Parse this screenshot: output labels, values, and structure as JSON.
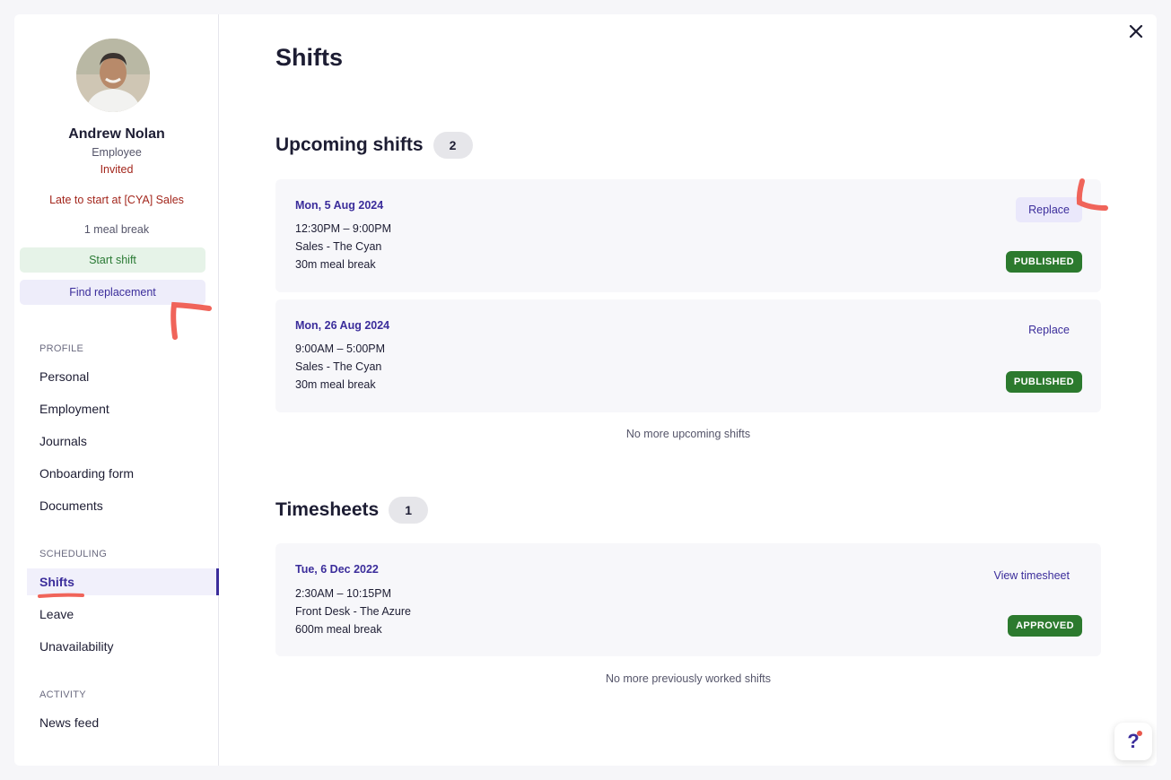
{
  "profile": {
    "name": "Andrew Nolan",
    "role": "Employee",
    "status": "Invited",
    "late_notice": "Late to start at [CYA] Sales",
    "meal_breaks": "1 meal break",
    "start_shift_label": "Start shift",
    "find_replacement_label": "Find replacement"
  },
  "sidebar": {
    "sections": [
      {
        "label": "PROFILE",
        "items": [
          "Personal",
          "Employment",
          "Journals",
          "Onboarding form",
          "Documents"
        ]
      },
      {
        "label": "SCHEDULING",
        "items": [
          "Shifts",
          "Leave",
          "Unavailability"
        ]
      },
      {
        "label": "ACTIVITY",
        "items": [
          "News feed"
        ]
      }
    ],
    "active_item": "Shifts"
  },
  "main": {
    "title": "Shifts",
    "upcoming": {
      "title": "Upcoming shifts",
      "count": "2",
      "shifts": [
        {
          "date": "Mon, 5 Aug 2024",
          "time": "12:30PM – 9:00PM",
          "location": "Sales - The Cyan",
          "break": "30m meal break",
          "action": "Replace",
          "status": "PUBLISHED"
        },
        {
          "date": "Mon, 26 Aug 2024",
          "time": "9:00AM – 5:00PM",
          "location": "Sales - The Cyan",
          "break": "30m meal break",
          "action": "Replace",
          "status": "PUBLISHED"
        }
      ],
      "empty_note": "No more upcoming shifts"
    },
    "timesheets": {
      "title": "Timesheets",
      "count": "1",
      "items": [
        {
          "date": "Tue, 6 Dec 2022",
          "time": "2:30AM – 10:15PM",
          "location": "Front Desk - The Azure",
          "break": "600m meal break",
          "action": "View timesheet",
          "status": "APPROVED"
        }
      ],
      "empty_note": "No more previously worked shifts"
    }
  },
  "help": {
    "label": "?"
  },
  "colors": {
    "accent": "#3b2d9b",
    "published": "#2c7a2e",
    "warning_text": "#a3261c",
    "annotation": "#f0645a"
  },
  "icons": {
    "close": "close-icon",
    "help": "help-icon"
  }
}
